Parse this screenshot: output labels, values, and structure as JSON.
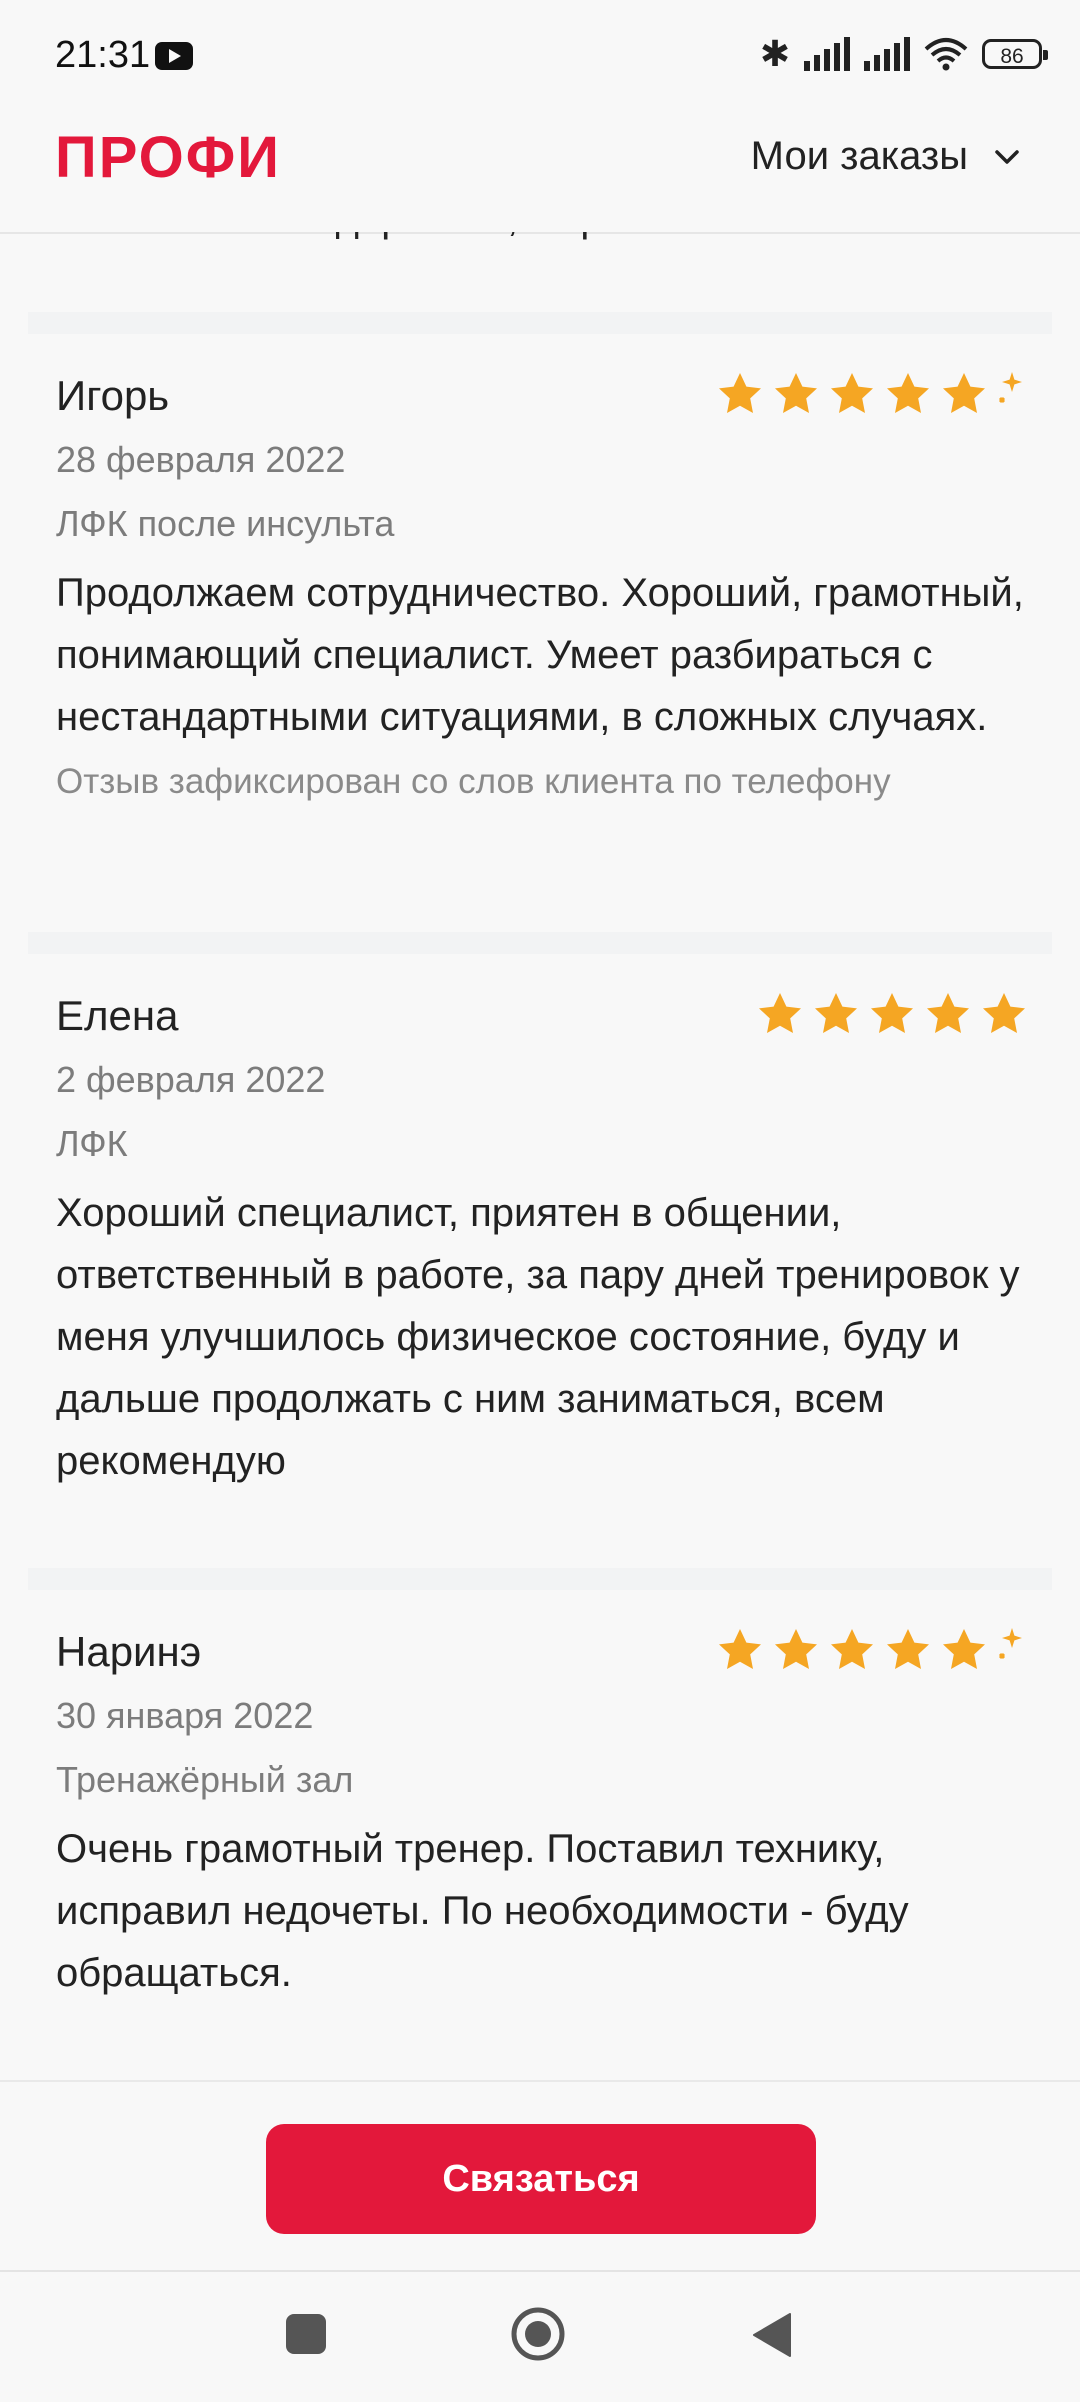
{
  "status_bar": {
    "time": "21:31",
    "battery": "86"
  },
  "header": {
    "logo": "ПРОФИ",
    "orders_label": "Мои заказы"
  },
  "previous_review_tail": "Большая благодарность, Сергей!",
  "reviews": [
    {
      "name": "Игорь",
      "date": "28 февраля 2022",
      "service": "ЛФК после инсульта",
      "text": "Продолжаем сотрудничество. Хороший, грамотный, понимающий специалист. Умеет разбираться с нестандартными ситуациями, в сложных случаях.",
      "note": "Отзыв зафиксирован со слов клиента по телефону",
      "rating": 5,
      "rating_icon": "star-with-sparkle"
    },
    {
      "name": "Елена",
      "date": "2 февраля 2022",
      "service": "ЛФК",
      "text": "Хороший специалист, приятен в общении, ответственный в работе, за пару дней тренировок у меня улучшилось физическое состояние, буду и дальше продолжать с ним заниматься, всем рекомендую",
      "note": "",
      "rating": 5,
      "rating_icon": "star"
    },
    {
      "name": "Наринэ",
      "date": "30 января 2022",
      "service": "Тренажёрный зал",
      "text": "Очень грамотный тренер. Поставил технику, исправил недочеты. По необходимости - буду обращаться.",
      "note": "",
      "rating": 5,
      "rating_icon": "star-with-sparkle"
    }
  ],
  "contact_button": {
    "label": "Связаться"
  },
  "colors": {
    "brand": "#e3183b",
    "star": "#f5a623",
    "sparkle": "#f5a623"
  },
  "nav_icons": [
    "recents-square-icon",
    "home-circle-icon",
    "back-triangle-icon"
  ]
}
